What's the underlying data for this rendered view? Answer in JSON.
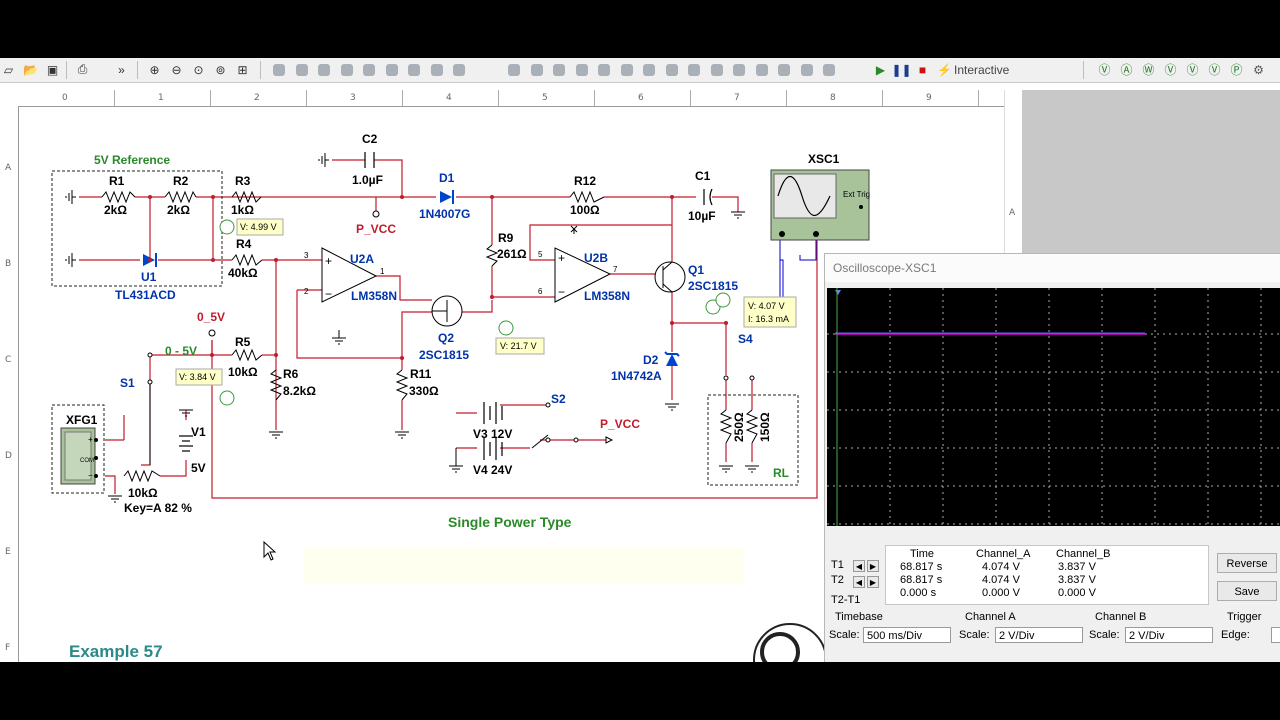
{
  "toolbar": {
    "interactive_label": "Interactive",
    "overflow_chevron": "»",
    "icons": [
      "new-icon",
      "open-icon",
      "save-icon",
      "print-icon",
      "zoom-in-icon",
      "zoom-out-icon",
      "zoom-area-icon",
      "zoom-fit-icon",
      "run-icon",
      "pause-icon",
      "stop-icon",
      "probe-icon"
    ]
  },
  "rulers": {
    "columns": [
      "0",
      "1",
      "2",
      "3",
      "4",
      "5",
      "6",
      "7",
      "8",
      "9"
    ],
    "rows": [
      "A",
      "B",
      "C",
      "D",
      "E",
      "F"
    ]
  },
  "schematic": {
    "title_5v_ref": "5V Reference",
    "r1": "R1",
    "r1_val": "2kΩ",
    "r2": "R2",
    "r2_val": "2kΩ",
    "r3": "R3",
    "r3_val": "1kΩ",
    "r4": "R4",
    "r4_val": "40kΩ",
    "r5": "R5",
    "r5_val": "10kΩ",
    "r6": "R6",
    "r6_val": "8.2kΩ",
    "r9": "R9",
    "r9_val": "261Ω",
    "r11": "R11",
    "r11_val": "330Ω",
    "r12": "R12",
    "r12_val": "100Ω",
    "c1": "C1",
    "c1_val": "10µF",
    "c2": "C2",
    "c2_val": "1.0µF",
    "d1": "D1",
    "d1_val": "1N4007G",
    "d2": "D2",
    "d2_val": "1N4742A",
    "u1": "U1",
    "u1_val": "TL431ACD",
    "u2a": "U2A",
    "u2a_val": "LM358N",
    "u2b": "U2B",
    "u2b_val": "LM358N",
    "q1": "Q1",
    "q1_val": "2SC1815",
    "q2": "Q2",
    "q2_val": "2SC1815",
    "xsc1": "XSC1",
    "ext_trig": "Ext Trig",
    "xfg1": "XFG1",
    "v1": "V1",
    "v1_val": "5V",
    "v3": "V3 12V",
    "v4": "V4 24V",
    "s1": "S1",
    "s2": "S2",
    "s4": "S4",
    "pvcc1": "P_VCC",
    "pvcc2": "P_VCC",
    "label_0_5v": "0_5V",
    "label_0_5v_range": "0 - 5V",
    "pot": "10kΩ",
    "pot_key": "Key=A  82 %",
    "rl": "RL",
    "rl_a": "250Ω",
    "rl_b": "150Ω",
    "pin3": "3",
    "pin2": "2",
    "pin1": "1",
    "pin5": "5",
    "pin6": "6",
    "pin7": "7",
    "single_power": "Single Power Type",
    "example": "Example 57",
    "probe1": "V: 4.99 V",
    "probe2": "V: 3.84 V",
    "probe3": "V: 21.7 V",
    "probe4_v": "V: 4.07 V",
    "probe4_i": "I: 16.3 mA"
  },
  "oscilloscope": {
    "title": "Oscilloscope-XSC1",
    "table": {
      "headers": [
        "Time",
        "Channel_A",
        "Channel_B"
      ],
      "t1_label": "T1",
      "t2_label": "T2",
      "diff_label": "T2-T1",
      "t1": [
        "68.817 s",
        "4.074 V",
        "3.837 V"
      ],
      "t2": [
        "68.817 s",
        "4.074 V",
        "3.837 V"
      ],
      "diff": [
        "0.000 s",
        "0.000 V",
        "0.000 V"
      ]
    },
    "reverse_button": "Reverse",
    "save_button": "Save",
    "timebase_label": "Timebase",
    "timebase_scale_label": "Scale:",
    "timebase_scale": "500 ms/Div",
    "channel_a_label": "Channel A",
    "channel_a_scale_label": "Scale:",
    "channel_a_scale": "2  V/Div",
    "channel_b_label": "Channel B",
    "channel_b_scale_label": "Scale:",
    "channel_b_scale": "2  V/Div",
    "trigger_label": "Trigger",
    "edge_label": "Edge:",
    "trace_a_color": "#ff00ff",
    "trace_b_color": "#6060ff"
  }
}
